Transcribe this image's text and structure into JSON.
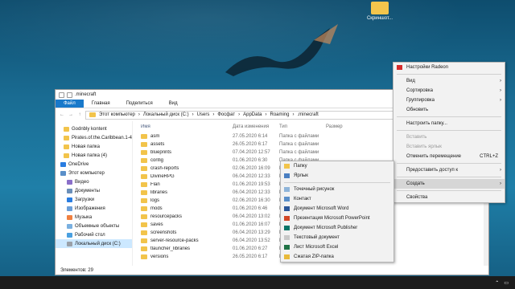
{
  "desktop": {
    "icon_label": "Скриншот..."
  },
  "explorer": {
    "title": ".minecraft",
    "ribbon_tabs": [
      "Файл",
      "Главная",
      "Поделиться",
      "Вид"
    ],
    "breadcrumbs": [
      "Этот компьютер",
      "Локальный диск (C:)",
      "Users",
      "Фосфат",
      "AppData",
      "Roaming",
      ".minecraft"
    ],
    "nav_items": [
      "Godnbly kontent",
      "Pirates.of.the.Caribbean.1-4",
      "Новая папка",
      "Новая папка (4)",
      "OneDrive",
      "Этот компьютер",
      "Видео",
      "Документы",
      "Загрузки",
      "Изображения",
      "Музыка",
      "Объемные объекты",
      "Рабочий стол",
      "Локальный диск (C:)"
    ],
    "columns": [
      "Имя",
      "Дата изменения",
      "Тип",
      "Размер"
    ],
    "rows": [
      {
        "name": "asm",
        "date": "27.05.2020 6:14",
        "type": "Папка с файлами"
      },
      {
        "name": "assets",
        "date": "26.05.2020 6:17",
        "type": "Папка с файлами"
      },
      {
        "name": "blueprints",
        "date": "07.04.2020 12:57",
        "type": "Папка с файлами"
      },
      {
        "name": "config",
        "date": "01.06.2020 6:30",
        "type": "Папка с файлами"
      },
      {
        "name": "crash-reports",
        "date": "02.06.2020 16:09",
        "type": "Папка с файлами"
      },
      {
        "name": "DivineRPG",
        "date": "06.04.2020 12:33",
        "type": "Папка с файлами"
      },
      {
        "name": "Flan",
        "date": "01.06.2020 19:53",
        "type": "Папка с файлами"
      },
      {
        "name": "libraries",
        "date": "06.04.2020 12:33",
        "type": "Папка с файлами"
      },
      {
        "name": "logs",
        "date": "02.06.2020 16:30",
        "type": "Папка с файлами"
      },
      {
        "name": "mods",
        "date": "01.06.2020 6:46",
        "type": "Папка с файлами"
      },
      {
        "name": "resourcepacks",
        "date": "06.04.2020 13:02",
        "type": "Папка с файлами"
      },
      {
        "name": "saves",
        "date": "01.06.2020 16:07",
        "type": "Папка с файлами"
      },
      {
        "name": "screenshots",
        "date": "06.04.2020 13:29",
        "type": "Папка с файлами"
      },
      {
        "name": "server-resource-packs",
        "date": "06.04.2020 13:52",
        "type": "Папка с файлами"
      },
      {
        "name": "tlauncher_libraries",
        "date": "01.06.2020 6:27",
        "type": "Папка с файлами"
      },
      {
        "name": "versions",
        "date": "26.05.2020 6:17",
        "type": "Папка с файлами"
      }
    ],
    "status": "Элементов: 29"
  },
  "context_menu": {
    "items": [
      {
        "label": "Настройки Radeon",
        "kind": "item"
      },
      {
        "kind": "sep"
      },
      {
        "label": "Вид",
        "kind": "sub"
      },
      {
        "label": "Сортировка",
        "kind": "sub"
      },
      {
        "label": "Группировка",
        "kind": "sub"
      },
      {
        "label": "Обновить",
        "kind": "item"
      },
      {
        "kind": "sep"
      },
      {
        "label": "Настроить папку...",
        "kind": "item"
      },
      {
        "kind": "sep"
      },
      {
        "label": "Вставить",
        "kind": "dis"
      },
      {
        "label": "Вставить ярлык",
        "kind": "dis"
      },
      {
        "label": "Отменить перемещение",
        "kind": "item",
        "shortcut": "CTRL+Z"
      },
      {
        "kind": "sep"
      },
      {
        "label": "Предоставить доступ к",
        "kind": "sub"
      },
      {
        "kind": "sep"
      },
      {
        "label": "Создать",
        "kind": "hi"
      },
      {
        "kind": "sep"
      },
      {
        "label": "Свойства",
        "kind": "item"
      }
    ]
  },
  "submenu": {
    "items": [
      {
        "label": "Папку",
        "icon": "folder-icon",
        "color": "#f2c44b"
      },
      {
        "label": "Ярлык",
        "icon": "shortcut-icon",
        "color": "#4a7fc1"
      },
      {
        "label": "sep"
      },
      {
        "label": "Точечный рисунок",
        "icon": "bitmap-icon",
        "color": "#8fb4d9"
      },
      {
        "label": "Контакт",
        "icon": "contact-icon",
        "color": "#5a8fc9"
      },
      {
        "label": "Документ Microsoft Word",
        "icon": "word-icon",
        "color": "#2b579a"
      },
      {
        "label": "Презентация Microsoft PowerPoint",
        "icon": "powerpoint-icon",
        "color": "#d24726"
      },
      {
        "label": "Документ Microsoft Publisher",
        "icon": "publisher-icon",
        "color": "#077568"
      },
      {
        "label": "Текстовый документ",
        "icon": "text-doc-icon",
        "color": "#c8c8c8"
      },
      {
        "label": "Лист Microsoft Excel",
        "icon": "excel-icon",
        "color": "#217346"
      },
      {
        "label": "Сжатая ZIP-папка",
        "icon": "zip-icon",
        "color": "#e8b93a"
      }
    ]
  }
}
